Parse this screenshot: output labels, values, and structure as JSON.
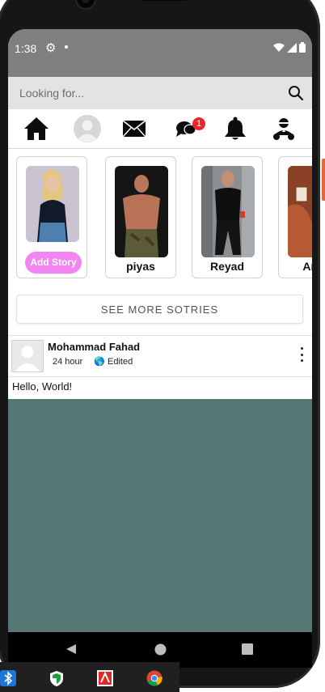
{
  "status_bar": {
    "time": "1:38"
  },
  "search": {
    "placeholder": "Looking for..."
  },
  "nav": {
    "messages_badge": "1"
  },
  "stories": {
    "add_label": "Add Story",
    "items": [
      {
        "name": "piyas"
      },
      {
        "name": "Reyad"
      },
      {
        "name": "Anu"
      }
    ],
    "see_more_label": "SEE MORE SOTRIES"
  },
  "post": {
    "author": "Mohammad Fahad",
    "time": "24 hour",
    "edited_label": "Edited",
    "text": "Hello, World!",
    "media_color": "#557874"
  },
  "colors": {
    "accent_pink": "#f286f0",
    "badge_red": "#e8262b",
    "status_bar": "#7f7f7f",
    "search_bg": "#e3e3e3"
  }
}
